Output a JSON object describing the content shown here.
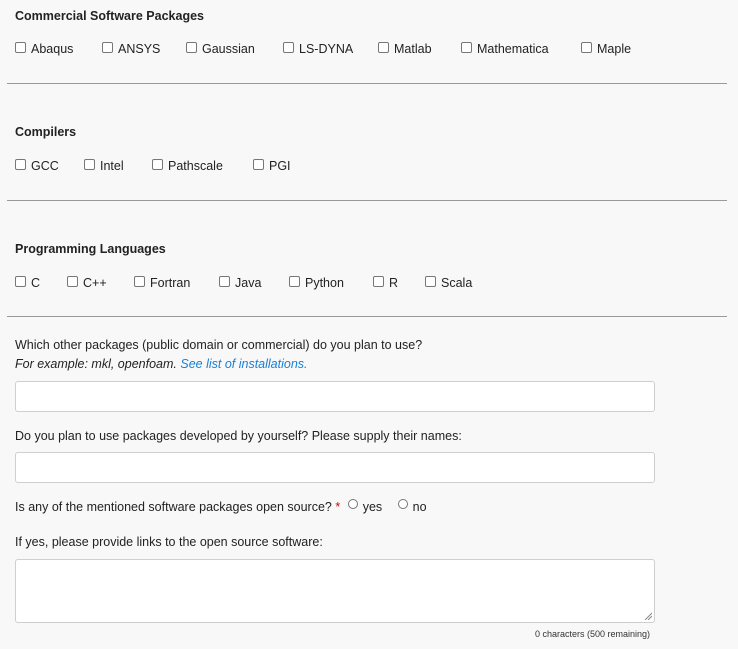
{
  "sections": {
    "commercial": {
      "title": "Commercial Software Packages",
      "items": [
        "Abaqus",
        "ANSYS",
        "Gaussian",
        "LS-DYNA",
        "Matlab",
        "Mathematica",
        "Maple"
      ]
    },
    "compilers": {
      "title": "Compilers",
      "items": [
        "GCC",
        "Intel",
        "Pathscale",
        "PGI"
      ]
    },
    "languages": {
      "title": "Programming Languages",
      "items": [
        "C",
        "C++",
        "Fortran",
        "Java",
        "Python",
        "R",
        "Scala"
      ]
    }
  },
  "questions": {
    "other_packages": {
      "label": "Which other packages (public domain or commercial) do you plan to use?",
      "hint_prefix": "For example: mkl, openfoam.",
      "hint_link": "See list of installations.",
      "value": ""
    },
    "own_packages": {
      "label": "Do you plan to use packages developed by yourself? Please supply their names:",
      "value": ""
    },
    "open_source": {
      "label": "Is any of the mentioned software packages open source?",
      "required_mark": "*",
      "options": [
        "yes",
        "no"
      ]
    },
    "links": {
      "label": "If yes, please provide links to the open source software:",
      "value": "",
      "counter": "0 characters (500 remaining)"
    }
  },
  "colors": {
    "link": "#1a7fd4",
    "required": "#dd0000"
  }
}
